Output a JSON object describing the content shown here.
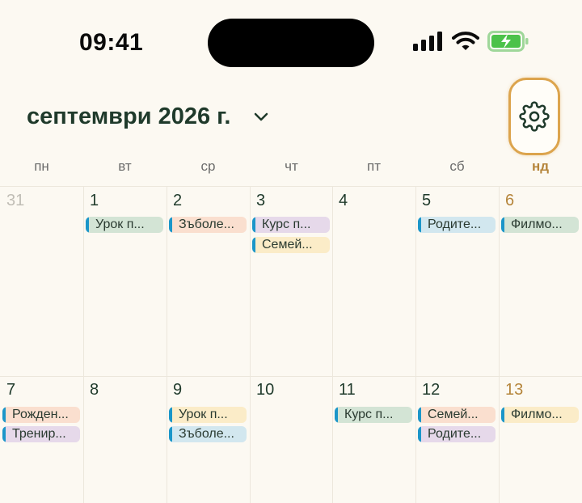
{
  "status_bar": {
    "time": "09:41"
  },
  "header": {
    "month_title": "септември 2026 г."
  },
  "weekdays": [
    "пн",
    "вт",
    "ср",
    "чт",
    "пт",
    "сб",
    "нд"
  ],
  "weeks": [
    {
      "days": [
        {
          "num": "31",
          "events": []
        },
        {
          "num": "1",
          "events": [
            "Урок п..."
          ]
        },
        {
          "num": "2",
          "events": [
            "Зъболе..."
          ]
        },
        {
          "num": "3",
          "events": [
            "Курс п...",
            "Семей..."
          ]
        },
        {
          "num": "4",
          "events": []
        },
        {
          "num": "5",
          "events": [
            "Родите..."
          ]
        },
        {
          "num": "6",
          "events": [
            "Филмо..."
          ]
        }
      ]
    },
    {
      "days": [
        {
          "num": "7",
          "events": [
            "Рожден...",
            "Тренир..."
          ]
        },
        {
          "num": "8",
          "events": []
        },
        {
          "num": "9",
          "events": [
            "Урок п...",
            "Зъболе..."
          ]
        },
        {
          "num": "10",
          "events": []
        },
        {
          "num": "11",
          "events": [
            "Курс п..."
          ]
        },
        {
          "num": "12",
          "events": [
            "Семей...",
            "Родите..."
          ]
        },
        {
          "num": "13",
          "events": [
            "Филмо..."
          ]
        }
      ]
    }
  ],
  "colors": {
    "background": "#fcf9f2",
    "title": "#1f3a2b",
    "sunday": "#b5853b",
    "highlight_ring": "#dca44d",
    "event_marker": "#1b96c9"
  }
}
